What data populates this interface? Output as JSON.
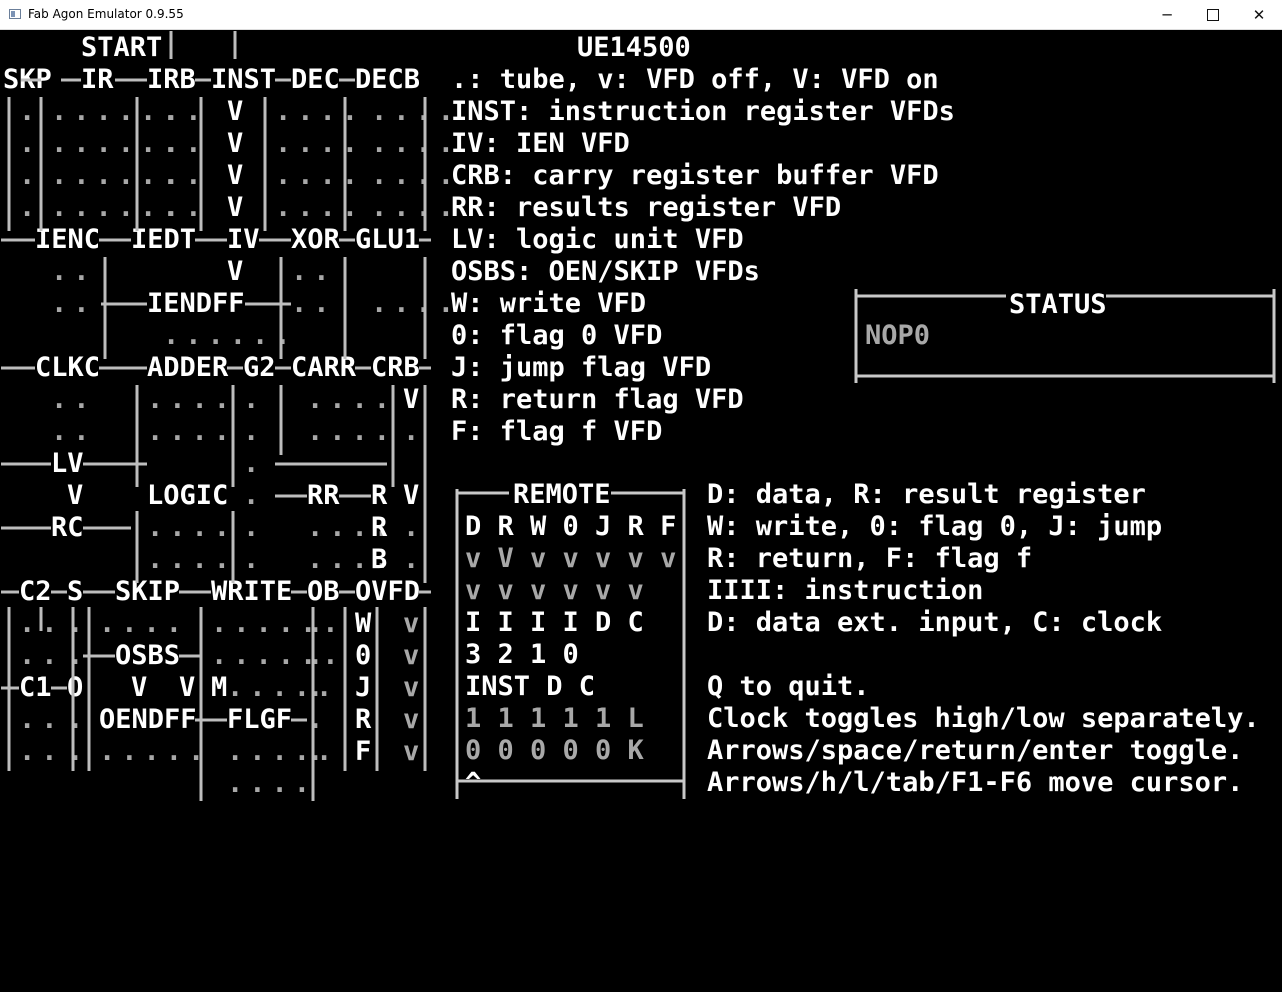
{
  "window": {
    "title": "Fab Agon Emulator 0.9.55",
    "minimize": "─",
    "close": "✕"
  },
  "screen": {
    "fg": "#ffffff",
    "dim": "#a8a8a8",
    "rows": [
      "     START| . |                    UE14500",
      "SKP──IR───IRB─INST─DEC─DECB  .: tube, v: VFD off, V: VFD on",
      "|.|.......|..| V |....|....| INST: instruction register VFDs",
      "|.|.......|..| V |....|....| IV: IEN VFD",
      "|.|.......|..| V |....|....| CRB: carry register buffer VFD",
      "|.|.......|..| V |....|....| RR: results register VFD",
      "──IENC──IEDT─IV──XOR─GLU1─ LV: logic unit VFD",
      "   ..  |     V  |.. |    | OSBS: OEN/SKIP VFDs",
      "   ..  |──IENDFF───.. |....| W: write VFD         |──────────STATUS────────────|",
      "       |   ......   |    | 0: flag 0 VFD         |NOP0                        |",
      "──CLKC────ADDER─G2─CARR─CRB─ J: jump flag VFD     |────────────────────────────|",
      "   ..   |....|.|  ....  V| R: return flag VFD",
      "   ..   |....|.|  ....  .| F: flag f VFD",
      "───LV───|    |.|────────|.|",
      "    V    LOGIC . ──RR──R V|  |────REMOTE────|  D: data, R: result register",
      "───RC───|....|.|  .... R .|  D R W 0 J R F   W: write, 0: flag 0, J: jump",
      "        |....|.|  .... B .|  v V v v v v v   R: return, F: flag f",
      "─C2─S──SKIP──WRITE─OB─OVFD─  v v v v   v v   IIII: instruction",
      "|..|.|.|....|......|.|W| v|  I I I I   D C   D: data ext. input, C: clock",
      "|..|.──OSBS─|......|.|0| v|  3 2 1 0",
      "─C1─O  V  V M|.....|.|J| v|   INST    D  C   Q to quit.",
      "|..|.|OENDFF─FLGF─|.|R| v|  1 1 1 1  1  L   Clock toggles high/low separately.",
      "|..|.|.....|.....|.|F| v|  0 0 0 0  0  K   Arrows/space/return/enter toggle.",
      "            |.... |      |^                 Arrows/h/l/tab/F1-F6 move cursor."
    ]
  },
  "panels": {
    "title_text": "UE14500",
    "legend": [
      ".: tube, v: VFD off, V: VFD on",
      "INST: instruction register VFDs",
      "IV: IEN VFD",
      "CRB: carry register buffer VFD",
      "RR: results register VFD",
      "LV: logic unit VFD",
      "OSBS: OEN/SKIP VFDs",
      "W: write VFD",
      "0: flag 0 VFD",
      "J: jump flag VFD",
      "R: return flag VFD",
      "F: flag f VFD"
    ],
    "status": {
      "label": "STATUS",
      "value": "NOP0"
    },
    "remote": {
      "label": "REMOTE",
      "header": "D R W 0 J R F",
      "row1": "v V v v v v v",
      "row2": "v v v v   v v",
      "row3": "I I I I   D C",
      "row4": "3 2 1 0",
      "row5": " INST    D  C",
      "row6": "1 1 1 1  1  L",
      "row7": "0 0 0 0  0  K",
      "cursor": "^"
    },
    "help": [
      "D: data, R: result register",
      "W: write, 0: flag 0, J: jump",
      "R: return, F: flag f",
      "IIII: instruction",
      "D: data ext. input, C: clock",
      "Q to quit.",
      "Clock toggles high/low separately.",
      "Arrows/space/return/enter toggle.",
      "Arrows/h/l/tab/F1-F6 move cursor."
    ],
    "diagram_labels": [
      "START",
      "SKP",
      "IR",
      "IRB",
      "INST",
      "DEC",
      "DECB",
      "IENC",
      "IEDT",
      "IV",
      "XOR",
      "GLU1",
      "IENDFF",
      "CLKC",
      "ADDER",
      "G2",
      "CARR",
      "CRB",
      "LV",
      "LOGIC",
      "RR",
      "RC",
      "C2",
      "S",
      "SKIP",
      "WRITE",
      "OB",
      "OVFD",
      "OSBS",
      "C1",
      "O",
      "M",
      "OENDFF",
      "FLGF"
    ]
  }
}
